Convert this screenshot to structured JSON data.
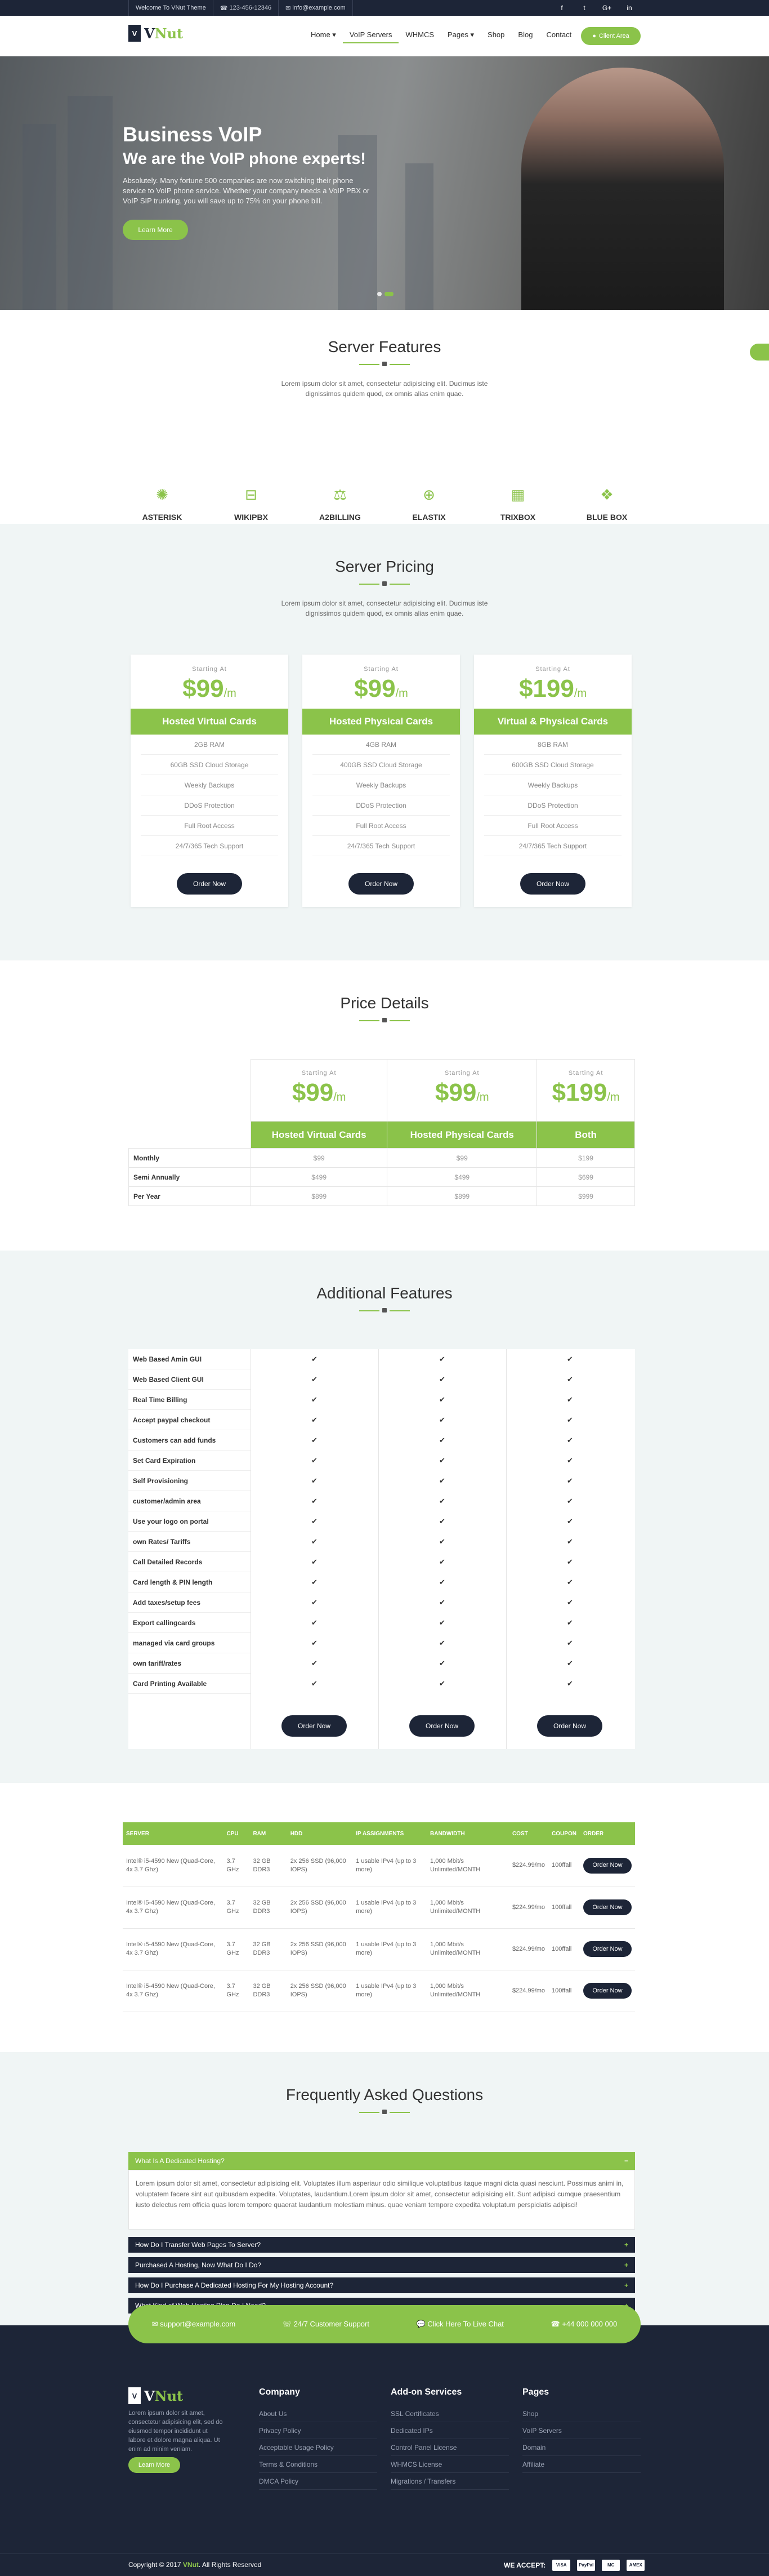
{
  "topbar": {
    "welcome": "Welcome To VNut Theme",
    "phone": "123-456-12346",
    "email": "info@example.com"
  },
  "nav": {
    "home": "Home",
    "voip": "VoIP Servers",
    "whmcs": "WHMCS",
    "pages": "Pages",
    "shop": "Shop",
    "blog": "Blog",
    "contact": "Contact",
    "client": "Client Area"
  },
  "hero": {
    "title": "Business VoIP",
    "subtitle": "We are the VoIP phone experts!",
    "text": "Absolutely. Many fortune 500 companies are now switching their phone service to VoIP phone service. Whether your company needs a VoIP PBX or VoIP SIP trunking, you will save up to 75% on your phone bill.",
    "button": "Learn More"
  },
  "features": {
    "title": "Server Features",
    "desc": "Lorem ipsum dolor sit amet, consectetur adipisicing elit. Ducimus iste dignissimos quidem quod, ex omnis alias enim quae.",
    "items": [
      "ASTERISK",
      "WIKIPBX",
      "A2BILLING",
      "ELASTIX",
      "TRIXBOX",
      "BLUE BOX"
    ]
  },
  "pricing": {
    "title": "Server Pricing",
    "desc": "Lorem ipsum dolor sit amet, consectetur adipisicing elit. Ducimus iste dignissimos quidem quod, ex omnis alias enim quae.",
    "start": "Starting At",
    "per": "/m",
    "order": "Order Now",
    "plans": [
      {
        "price": "$99",
        "name": "Hosted Virtual Cards",
        "f": [
          "2GB RAM",
          "60GB SSD Cloud Storage",
          "Weekly Backups",
          "DDoS Protection",
          "Full Root Access",
          "24/7/365 Tech Support"
        ]
      },
      {
        "price": "$99",
        "name": "Hosted Physical Cards",
        "f": [
          "4GB RAM",
          "400GB SSD Cloud Storage",
          "Weekly Backups",
          "DDoS Protection",
          "Full Root Access",
          "24/7/365 Tech Support"
        ]
      },
      {
        "price": "$199",
        "name": "Virtual & Physical Cards",
        "f": [
          "8GB RAM",
          "600GB SSD Cloud Storage",
          "Weekly Backups",
          "DDoS Protection",
          "Full Root Access",
          "24/7/365 Tech Support"
        ]
      }
    ]
  },
  "price_details": {
    "title": "Price Details",
    "start": "Starting At",
    "per": "/m",
    "cols": [
      {
        "price": "$99",
        "name": "Hosted Virtual Cards"
      },
      {
        "price": "$99",
        "name": "Hosted Physical Cards"
      },
      {
        "price": "$199",
        "name": "Both"
      }
    ],
    "rows": [
      {
        "label": "Monthly",
        "v": [
          "$99",
          "$99",
          "$199"
        ]
      },
      {
        "label": "Semi Annually",
        "v": [
          "$499",
          "$499",
          "$699"
        ]
      },
      {
        "label": "Per Year",
        "v": [
          "$899",
          "$899",
          "$999"
        ]
      }
    ]
  },
  "additional": {
    "title": "Additional Features",
    "order": "Order Now",
    "check": "✔",
    "rows": [
      "Web Based Amin GUI",
      "Web Based Client GUI",
      "Real Time Billing",
      "Accept paypal checkout",
      "Customers can add funds",
      "Set Card Expiration",
      "Self Provisioning",
      "customer/admin area",
      "Use your logo on portal",
      "own Rates/ Tariffs",
      "Call Detailed Records",
      "Card length & PIN length",
      "Add taxes/setup fees",
      "Export callingcards",
      "managed via card groups",
      "own tariff/rates",
      "Card Printing Available"
    ]
  },
  "servers": {
    "headers": [
      "SERVER",
      "CPU",
      "RAM",
      "HDD",
      "IP ASSIGNMENTS",
      "BANDWIDTH",
      "COST",
      "COUPON",
      "ORDER"
    ],
    "order": "Order Now",
    "rows": [
      [
        "Intel® i5-4590 New (Quad-Core, 4x 3.7 Ghz)",
        "3.7 GHz",
        "32 GB DDR3",
        "2x 256 SSD (96,000 IOPS)",
        "1 usable IPv4 (up to 3 more)",
        "1,000 Mbit/s Unlimited/MONTH",
        "$224.99/mo",
        "100ffall"
      ],
      [
        "Intel® i5-4590 New (Quad-Core, 4x 3.7 Ghz)",
        "3.7 GHz",
        "32 GB DDR3",
        "2x 256 SSD (96,000 IOPS)",
        "1 usable IPv4 (up to 3 more)",
        "1,000 Mbit/s Unlimited/MONTH",
        "$224.99/mo",
        "100ffall"
      ],
      [
        "Intel® i5-4590 New (Quad-Core, 4x 3.7 Ghz)",
        "3.7 GHz",
        "32 GB DDR3",
        "2x 256 SSD (96,000 IOPS)",
        "1 usable IPv4 (up to 3 more)",
        "1,000 Mbit/s Unlimited/MONTH",
        "$224.99/mo",
        "100ffall"
      ],
      [
        "Intel® i5-4590 New (Quad-Core, 4x 3.7 Ghz)",
        "3.7 GHz",
        "32 GB DDR3",
        "2x 256 SSD (96,000 IOPS)",
        "1 usable IPv4 (up to 3 more)",
        "1,000 Mbit/s Unlimited/MONTH",
        "$224.99/mo",
        "100ffall"
      ]
    ]
  },
  "faq": {
    "title": "Frequently Asked Questions",
    "open_q": "What Is A Dedicated Hosting?",
    "open_a": "Lorem ipsum dolor sit amet, consectetur adipisicing elit. Voluptates illum asperiaur odio similique voluptatibus itaque magni dicta quasi nesciunt. Possimus animi in, voluptatem facere sint aut quibusdam expedita. Voluptates, laudantium.Lorem ipsum dolor sit amet, consectetur adipisicing elit. Sunt adipisci cumque praesentium iusto delectus rem officia quas lorem tempore quaerat laudantium molestiam minus. quae veniam tempore expedita voluptatum perspiciatis adipisci!",
    "items": [
      "How Do I Transfer Web Pages To Server?",
      "Purchased A Hosting, Now What Do I Do?",
      "How Do I Purchase A Dedicated Hosting For My Hosting Account?",
      "What Kind of Web Hosting Plan Do I Need?"
    ]
  },
  "footer": {
    "email": "support@example.com",
    "support": "24/7 Customer Support",
    "chat": "Click Here To Live Chat",
    "phone": "+44 000 000 000",
    "desc": "Lorem ipsum dolor sit amet, consectetur adipisicing elit, sed do eiusmod tempor incididunt ut labore et dolore magna aliqua. Ut enim ad minim veniam.",
    "learn": "Learn More",
    "company": {
      "title": "Company",
      "links": [
        "About Us",
        "Privacy Policy",
        "Acceptable Usage Policy",
        "Terms & Conditions",
        "DMCA Policy"
      ]
    },
    "addons": {
      "title": "Add-on Services",
      "links": [
        "SSL Certificates",
        "Dedicated IPs",
        "Control Panel License",
        "WHMCS License",
        "Migrations / Transfers"
      ]
    },
    "pages": {
      "title": "Pages",
      "links": [
        "Shop",
        "VoIP Servers",
        "Domain",
        "Affiliate"
      ]
    },
    "copy_pre": "Copyright © 2017 ",
    "copy_brand": "VNut",
    "copy_post": ". All Rights Reserved",
    "accept": "WE ACCEPT:",
    "cards": [
      "VISA",
      "PayPal",
      "MC",
      "AMEX"
    ]
  },
  "colors": {
    "accent": "#8bc34a",
    "dark": "#1d2537"
  }
}
